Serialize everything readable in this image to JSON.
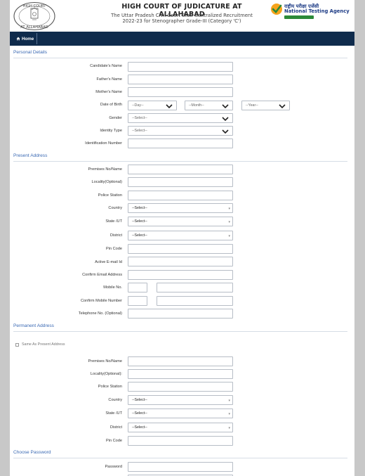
{
  "header": {
    "title": "HIGH COURT OF JUDICATURE AT ALLAHABAD",
    "subtitle_line1": "The Uttar Pradesh Civil Court Staff Centralized Recruitment",
    "subtitle_line2": "2022-23 for Stenographer Grade-III (Category 'C')",
    "logo_text_top": "HIGH COURT",
    "logo_text_bottom": "AT ALLAHABAD",
    "nta_hindi": "राष्ट्रीय परीक्षा एजेंसी",
    "nta_english": "National Testing Agency"
  },
  "nav": {
    "home": "Home"
  },
  "personal": {
    "title": "Personal Details",
    "candidate_name": "Candidate's Name",
    "father_name": "Father's Name",
    "mother_name": "Mother's Name",
    "dob": "Date of Birth",
    "dob_day": "--Day--",
    "dob_month": "--Month--",
    "dob_year": "--Year--",
    "gender": "Gender",
    "gender_value": "--Select--",
    "identity_type": "Identity Type",
    "identity_value": "--Select--",
    "identification_number": "Identification Number"
  },
  "present": {
    "title": "Present Address",
    "premises": "Premises No/Name",
    "locality": "Locality(Optional)",
    "police_station": "Police Station",
    "country": "Country",
    "country_value": "--Select--",
    "state": "State /UT",
    "state_value": "--Select--",
    "district": "District",
    "district_value": "--Select--",
    "pin_code": "Pin Code",
    "email": "Active E-mail Id",
    "confirm_email": "Confirm Email Address",
    "mobile": "Mobile No.",
    "confirm_mobile": "Confirm Mobile Number",
    "telephone": "Telephone No. (Optional)"
  },
  "permanent": {
    "title": "Permanent Address",
    "same_as_present": "Same As Present Address",
    "premises": "Premises No/Name",
    "locality": "Locality(Optional):",
    "police_station": "Police Station",
    "country": "Country",
    "country_value": "--Select--",
    "state": "State /UT",
    "state_value": "--Select--",
    "district": "District",
    "district_value": "--Select--",
    "pin_code": "Pin Code"
  },
  "password": {
    "title": "Choose Password",
    "password": "Password"
  }
}
